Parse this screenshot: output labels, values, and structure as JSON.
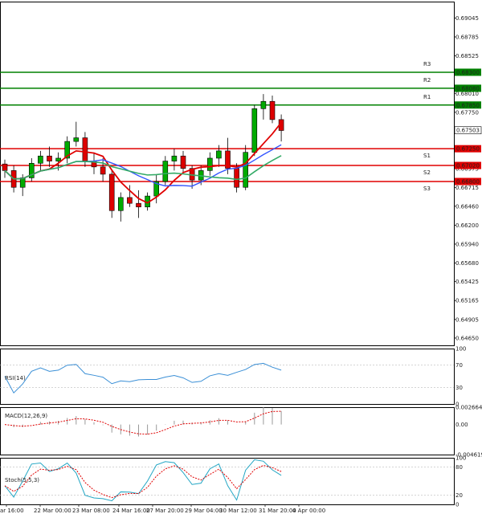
{
  "colors": {
    "support": "#e00000",
    "resistance": "#008000",
    "bull_fill": "#00aa00",
    "bear_fill": "#dd0000",
    "ma_fast": "#e00000",
    "ma_mid": "#3355ff",
    "ma_slow": "#33aa66",
    "rsi": "#3a8fd6",
    "macd_hist": "#999999",
    "macd_signal": "#e00000",
    "stoch_main": "#22a6c4",
    "stoch_signal": "#e00000",
    "current_price_bg": "#ffffff"
  },
  "price_scale": {
    "ticks": [
      "0.69045",
      "0.68785",
      "0.68525",
      "0.68010",
      "0.67750",
      "0.67495",
      "0.67235",
      "0.66975",
      "0.66715",
      "0.66460",
      "0.66200",
      "0.65940",
      "0.65680",
      "0.65425",
      "0.65165",
      "0.64905",
      "0.64650"
    ]
  },
  "levels": [
    {
      "name": "R3",
      "value": "0.68300",
      "type": "resistance"
    },
    {
      "name": "R2",
      "value": "0.68080",
      "type": "resistance"
    },
    {
      "name": "R1",
      "value": "0.67850",
      "type": "resistance"
    },
    {
      "name": "S1",
      "value": "0.67250",
      "type": "support"
    },
    {
      "name": "S2",
      "value": "0.67020",
      "type": "support"
    },
    {
      "name": "S3",
      "value": "0.66800",
      "type": "support"
    }
  ],
  "current_price": "0.67503",
  "time_axis": [
    "ar 16:00",
    "22 Mar 00:00",
    "23 Mar 08:00",
    "24 Mar 16:00",
    "27 Mar 20:00",
    "29 Mar 04:00",
    "30 Mar 12:00",
    "31 Mar 20:00",
    "4 Apr 00:00"
  ],
  "rsi": {
    "label": "RSI(14)",
    "ticks": [
      "100",
      "70",
      "30",
      "0"
    ]
  },
  "macd": {
    "label": "MACD(12,26,9)",
    "ticks": [
      "0.002664",
      "0.00",
      "-0.004619"
    ]
  },
  "stoch": {
    "label": "Stoch(5,5,3)",
    "ticks": [
      "100",
      "80",
      "20",
      "0"
    ]
  },
  "chart_data": [
    {
      "type": "candlestick",
      "candles": [
        [
          0.6704,
          0.671,
          0.6685,
          0.6695
        ],
        [
          0.6695,
          0.6702,
          0.6665,
          0.6672
        ],
        [
          0.6672,
          0.669,
          0.666,
          0.6685
        ],
        [
          0.6685,
          0.6712,
          0.668,
          0.6705
        ],
        [
          0.6705,
          0.6722,
          0.6695,
          0.6715
        ],
        [
          0.6715,
          0.6728,
          0.67,
          0.6708
        ],
        [
          0.6708,
          0.672,
          0.6695,
          0.6712
        ],
        [
          0.6712,
          0.6742,
          0.6705,
          0.6735
        ],
        [
          0.6735,
          0.6762,
          0.6728,
          0.674
        ],
        [
          0.674,
          0.6748,
          0.67,
          0.6708
        ],
        [
          0.6708,
          0.672,
          0.669,
          0.67
        ],
        [
          0.67,
          0.6712,
          0.668,
          0.669
        ],
        [
          0.669,
          0.6695,
          0.663,
          0.664
        ],
        [
          0.664,
          0.6665,
          0.6625,
          0.6658
        ],
        [
          0.6658,
          0.6675,
          0.6645,
          0.665
        ],
        [
          0.665,
          0.6668,
          0.663,
          0.6645
        ],
        [
          0.6645,
          0.6665,
          0.664,
          0.666
        ],
        [
          0.666,
          0.669,
          0.665,
          0.668
        ],
        [
          0.668,
          0.6715,
          0.6675,
          0.6708
        ],
        [
          0.6708,
          0.6725,
          0.6695,
          0.6715
        ],
        [
          0.6715,
          0.6722,
          0.669,
          0.6698
        ],
        [
          0.6698,
          0.6702,
          0.667,
          0.6682
        ],
        [
          0.6682,
          0.6702,
          0.6675,
          0.6695
        ],
        [
          0.6695,
          0.672,
          0.6688,
          0.6712
        ],
        [
          0.6712,
          0.673,
          0.67,
          0.6722
        ],
        [
          0.6722,
          0.674,
          0.669,
          0.6698
        ],
        [
          0.6698,
          0.6705,
          0.6665,
          0.6672
        ],
        [
          0.6672,
          0.673,
          0.6668,
          0.672
        ],
        [
          0.672,
          0.6785,
          0.6715,
          0.678
        ],
        [
          0.678,
          0.68,
          0.6765,
          0.679
        ],
        [
          0.679,
          0.6798,
          0.676,
          0.6765
        ],
        [
          0.6765,
          0.6772,
          0.6735,
          0.675
        ]
      ]
    }
  ]
}
